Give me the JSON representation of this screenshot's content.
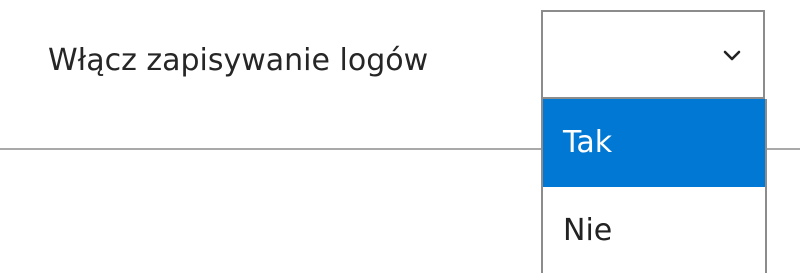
{
  "setting": {
    "label": "Włącz zapisywanie logów"
  },
  "select": {
    "current_value": "",
    "icon": "chevron-down-icon"
  },
  "dropdown": {
    "options": [
      {
        "label": "Tak",
        "highlighted": true
      },
      {
        "label": "Nie",
        "highlighted": false
      }
    ],
    "highlight_color": "#0078d4"
  }
}
